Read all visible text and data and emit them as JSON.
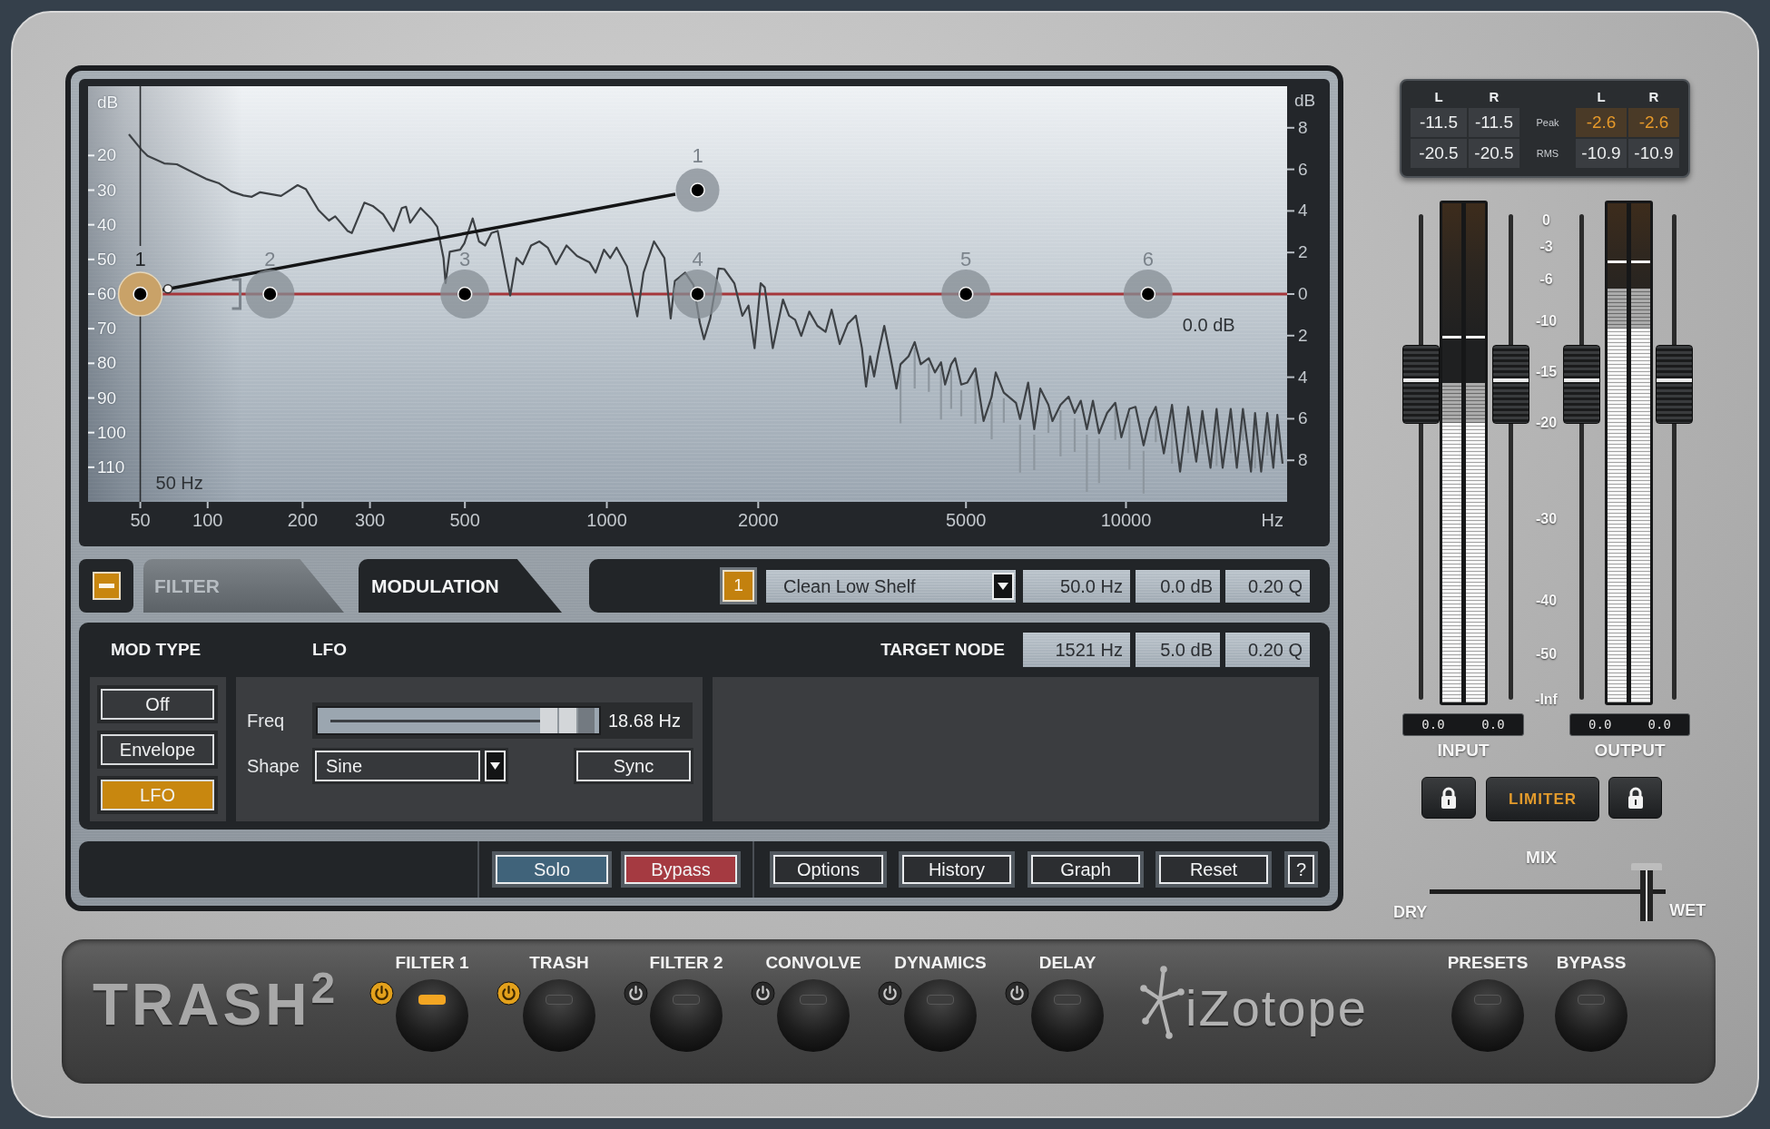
{
  "graph": {
    "spectrum_scale": {
      "unit": "dB",
      "ticks": [
        "20",
        "30",
        "40",
        "50",
        "60",
        "70",
        "80",
        "90",
        "100",
        "110"
      ]
    },
    "gain_scale": {
      "unit": "dB",
      "ticks": [
        "8",
        "6",
        "4",
        "2",
        "0",
        "2",
        "4",
        "6",
        "8"
      ]
    },
    "frequency_axis": {
      "unit": "Hz",
      "ticks": [
        "50",
        "100",
        "200",
        "300",
        "500",
        "1000",
        "2000",
        "5000",
        "10000"
      ]
    },
    "nodes": [
      {
        "label": "1",
        "selected": true
      },
      {
        "label": "2",
        "selected": false
      },
      {
        "label": "3",
        "selected": false
      },
      {
        "label": "4",
        "selected": false
      },
      {
        "label": "5",
        "selected": false
      },
      {
        "label": "6",
        "selected": false
      }
    ],
    "target_node": {
      "label": "1"
    },
    "cursor": {
      "label": "50 Hz"
    },
    "readout": "0.0 dB"
  },
  "tabs": [
    {
      "label": "FILTER",
      "selected": false
    },
    {
      "label": "MODULATION",
      "selected": true
    }
  ],
  "node_bar": {
    "node": "1",
    "filter_type": "Clean Low Shelf",
    "fields": [
      "50.0 Hz",
      "0.0 dB",
      "0.20 Q"
    ]
  },
  "modulation": {
    "mod_type": {
      "title": "MOD TYPE",
      "options": [
        {
          "label": "Off",
          "selected": false
        },
        {
          "label": "Envelope",
          "selected": false
        },
        {
          "label": "LFO",
          "selected": true
        }
      ]
    },
    "lfo": {
      "title": "LFO",
      "freq": {
        "label": "Freq",
        "level": 0.98,
        "reading": "18.68 Hz"
      },
      "shape": {
        "label": "Shape",
        "value": "Sine"
      },
      "sync": "Sync"
    },
    "target_node": {
      "title": "TARGET NODE",
      "fields": [
        "1521 Hz",
        "5.0 dB",
        "0.20 Q"
      ]
    }
  },
  "toolbar": [
    {
      "label": "Solo",
      "kind": "solo"
    },
    {
      "label": "Bypass",
      "kind": "bypass"
    },
    {
      "label": "Options",
      "kind": "plain"
    },
    {
      "label": "History",
      "kind": "plain"
    },
    {
      "label": "Graph",
      "kind": "plain"
    },
    {
      "label": "Reset",
      "kind": "plain"
    },
    {
      "label": "?",
      "kind": "help"
    }
  ],
  "levels": {
    "columns": [
      "L",
      "R",
      "L",
      "R"
    ],
    "rows": [
      {
        "label": "Peak",
        "cells": [
          {
            "text": "-11.5",
            "hot": false
          },
          {
            "text": "-11.5",
            "hot": false
          },
          {
            "text": "-2.6",
            "hot": true
          },
          {
            "text": "-2.6",
            "hot": true
          }
        ]
      },
      {
        "label": "RMS",
        "cells": [
          {
            "text": "-20.5",
            "hot": false
          },
          {
            "text": "-20.5",
            "hot": false
          },
          {
            "text": "-10.9",
            "hot": false
          },
          {
            "text": "-10.9",
            "hot": false
          }
        ]
      }
    ]
  },
  "meters": {
    "scale": [
      "0",
      "-3",
      "-6",
      "-10",
      "-15",
      "-20",
      "-30",
      "-40",
      "-50",
      "-Inf"
    ],
    "input": {
      "label": "INPUT",
      "faders": [
        {
          "level": 0.65
        },
        {
          "level": 0.65
        }
      ],
      "channels": [
        {
          "rms": {
            "level": 0.56
          },
          "peak": {
            "level": 0.64
          },
          "hold": {
            "level": 0.73
          }
        },
        {
          "rms": {
            "level": 0.56
          },
          "peak": {
            "level": 0.64
          },
          "hold": {
            "level": 0.73
          }
        }
      ],
      "readouts": [
        "0.0",
        "0.0"
      ]
    },
    "output": {
      "label": "OUTPUT",
      "faders": [
        {
          "level": 0.65
        },
        {
          "level": 0.65
        }
      ],
      "channels": [
        {
          "rms": {
            "level": 0.75
          },
          "peak": {
            "level": 0.83
          },
          "hold": {
            "level": 0.88
          }
        },
        {
          "rms": {
            "level": 0.75
          },
          "peak": {
            "level": 0.83
          },
          "hold": {
            "level": 0.88
          }
        }
      ],
      "readouts": [
        "0.0",
        "0.0"
      ]
    },
    "limiter": {
      "label": "LIMITER",
      "on": true
    }
  },
  "mix": {
    "label": "MIX",
    "left": "DRY",
    "right": "WET",
    "level": 0.98
  },
  "brand": {
    "product": "TRASH$^{2}$",
    "company": "iZotope"
  },
  "modules": [
    {
      "label": "FILTER 1",
      "on": true,
      "selected": true
    },
    {
      "label": "TRASH",
      "on": true,
      "selected": false
    },
    {
      "label": "FILTER 2",
      "on": false,
      "selected": false
    },
    {
      "label": "CONVOLVE",
      "on": false,
      "selected": false
    },
    {
      "label": "DYNAMICS",
      "on": false,
      "selected": false
    },
    {
      "label": "DELAY",
      "on": false,
      "selected": false
    }
  ],
  "global_knobs": [
    {
      "label": "PRESETS"
    },
    {
      "label": "BYPASS"
    }
  ]
}
